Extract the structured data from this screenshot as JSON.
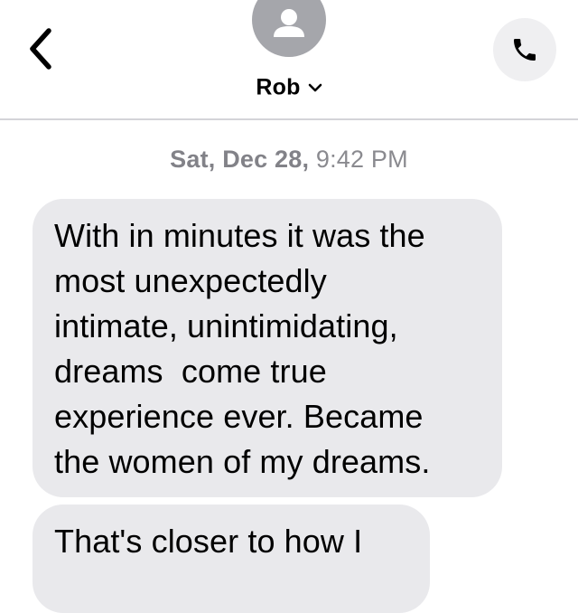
{
  "header": {
    "contact_name": "Rob",
    "avatar_icon": "person-silhouette-icon",
    "back_icon": "chevron-left-icon",
    "name_chevron_icon": "chevron-down-icon",
    "call_icon": "phone-icon"
  },
  "thread": {
    "timestamp_day": "Sat, Dec 28,",
    "timestamp_time": "9:42 PM",
    "messages": [
      {
        "direction": "incoming",
        "lines": [
          "With in minutes it was the",
          "most unexpectedly",
          "intimate, unintimidating,",
          "dreams  come true",
          "experience ever. Became",
          "the women of my dreams."
        ]
      },
      {
        "direction": "incoming",
        "lines": [
          "That's closer to how I"
        ]
      }
    ]
  },
  "colors": {
    "incoming_bubble": "#e9e9ec",
    "avatar_bg": "#a5a6ab",
    "call_button_bg": "#efeff1",
    "timestamp_text": "#8a8a8f",
    "divider": "#d4d4d8"
  }
}
